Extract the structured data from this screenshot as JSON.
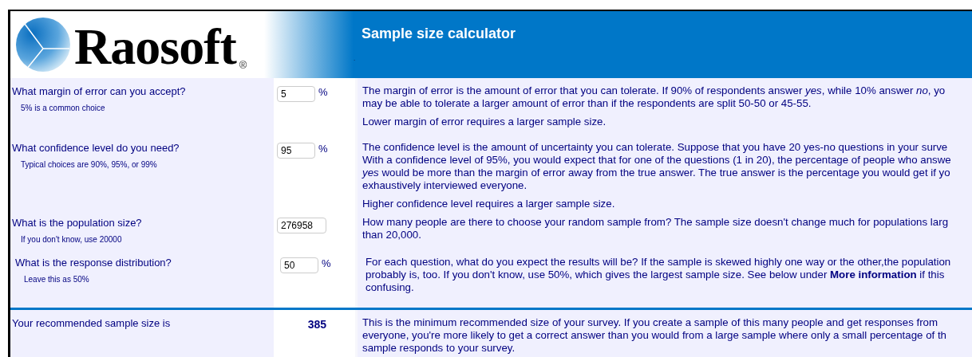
{
  "header": {
    "logo_text": "Raosoft",
    "registered_mark": "®",
    "title": "Sample size calculator",
    "dot": "."
  },
  "questions": [
    {
      "question": "What margin of error can you accept?",
      "hint": "5% is a common choice",
      "value": "5",
      "unit": "%",
      "description": [
        [
          "The margin of error is the amount of error that you can tolerate. If 90% of respondents answer *yes*, while 10% answer *no*, yo",
          "may be able to tolerate a larger amount of error than if the respondents are split 50-50 or 45-55."
        ],
        [
          "Lower margin of error requires a larger sample size."
        ]
      ]
    },
    {
      "question": "What confidence level do you need?",
      "hint": "Typical choices are 90%, 95%, or 99%",
      "value": "95",
      "unit": "%",
      "description": [
        [
          "The confidence level is the amount of uncertainty you can tolerate. Suppose that you have 20 yes-no questions in your surve",
          "With a confidence level of 95%, you would expect that for one of the questions (1 in 20), the percentage of people who answe",
          "*yes* would be more than the margin of error away from the true answer. The true answer is the percentage you would get if yo",
          "exhaustively interviewed everyone."
        ],
        [
          "Higher confidence level requires a larger sample size."
        ]
      ]
    },
    {
      "question": "What is the population size?",
      "hint": "If you don't know, use 20000",
      "value": "276958",
      "description": [
        [
          "How many people are there to choose your random sample from? The sample size doesn't change much for populations larg",
          "than 20,000."
        ]
      ]
    },
    {
      "question": "What is the response distribution?",
      "hint": "Leave this as 50%",
      "value": "50",
      "unit": "%",
      "description": [
        [
          "For each question, what do you expect the results will be? If the sample is skewed highly one way or the other,the population",
          "probably is, too. If you don't know, use 50%, which gives the largest sample size. See below under **More information** if this",
          "confusing."
        ]
      ]
    }
  ],
  "result": {
    "label": "Your recommended sample size is",
    "value": "385",
    "description": [
      [
        "This is the minimum recommended size of your survey. If you create a sample of this many people and get responses from",
        "everyone, you're more likely to get a correct answer than you would from a large sample where only a small percentage of th",
        "sample responds to your survey."
      ]
    ]
  }
}
